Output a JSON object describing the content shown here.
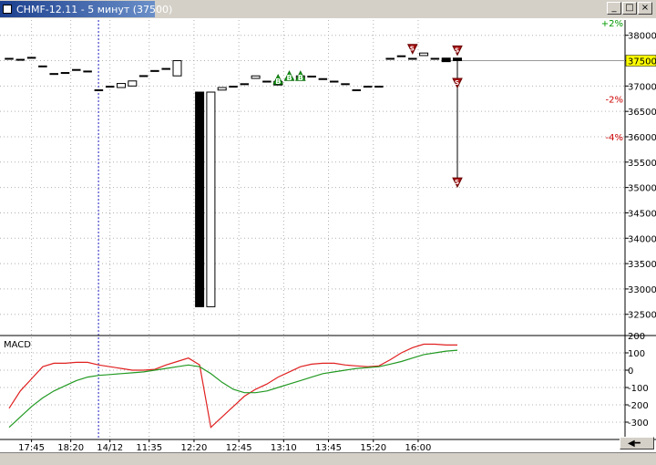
{
  "window": {
    "title": "CHMF-12.11 - 5 минут (37500)",
    "buttons": [
      "_",
      "□",
      "×"
    ]
  },
  "chart_data": [
    {
      "type": "candlestick",
      "name": "price-chart",
      "ylim": [
        32100,
        38300
      ],
      "yticks": [
        32500,
        33000,
        33500,
        34000,
        34500,
        35000,
        35500,
        36000,
        36500,
        37000,
        37500,
        38000
      ],
      "current_price_label": "37500",
      "current_price": 37500,
      "percent_markers": [
        {
          "label": "+2%",
          "value": 38250,
          "color": "#009900"
        },
        {
          "label": "-2%",
          "value": 36750,
          "color": "#cc0000"
        },
        {
          "label": "-4%",
          "value": 36000,
          "color": "#cc0000"
        }
      ],
      "candles": [
        {
          "i": 0,
          "o": 37550,
          "h": 37550,
          "l": 37550,
          "c": 37550
        },
        {
          "i": 1,
          "o": 37530,
          "h": 37530,
          "l": 37530,
          "c": 37530
        },
        {
          "i": 2,
          "o": 37570,
          "h": 37570,
          "l": 37570,
          "c": 37570
        },
        {
          "i": 3,
          "o": 37400,
          "h": 37400,
          "l": 37400,
          "c": 37400
        },
        {
          "i": 4,
          "o": 37250,
          "h": 37250,
          "l": 37250,
          "c": 37250
        },
        {
          "i": 5,
          "o": 37270,
          "h": 37270,
          "l": 37270,
          "c": 37270
        },
        {
          "i": 6,
          "o": 37330,
          "h": 37330,
          "l": 37330,
          "c": 37330
        },
        {
          "i": 7,
          "o": 37300,
          "h": 37300,
          "l": 37300,
          "c": 37300
        },
        {
          "i": 8,
          "o": 36930,
          "h": 36930,
          "l": 36930,
          "c": 36930
        },
        {
          "i": 9,
          "o": 37000,
          "h": 37000,
          "l": 37000,
          "c": 37000
        },
        {
          "i": 10,
          "o": 36970,
          "h": 37050,
          "l": 36970,
          "c": 37050
        },
        {
          "i": 11,
          "o": 37000,
          "h": 37100,
          "l": 37000,
          "c": 37100
        },
        {
          "i": 12,
          "o": 37210,
          "h": 37210,
          "l": 37210,
          "c": 37210
        },
        {
          "i": 13,
          "o": 37310,
          "h": 37310,
          "l": 37310,
          "c": 37310
        },
        {
          "i": 14,
          "o": 37350,
          "h": 37350,
          "l": 37350,
          "c": 37350
        },
        {
          "i": 15,
          "o": 37200,
          "h": 37500,
          "l": 37200,
          "c": 37500
        },
        {
          "i": 17,
          "o": 36880,
          "h": 36880,
          "l": 32650,
          "c": 32650
        },
        {
          "i": 18,
          "o": 32650,
          "h": 36880,
          "l": 32650,
          "c": 36880
        },
        {
          "i": 19,
          "o": 36920,
          "h": 36970,
          "l": 36920,
          "c": 36970
        },
        {
          "i": 20,
          "o": 37000,
          "h": 37000,
          "l": 37000,
          "c": 37000
        },
        {
          "i": 21,
          "o": 37050,
          "h": 37050,
          "l": 37050,
          "c": 37050
        },
        {
          "i": 22,
          "o": 37150,
          "h": 37200,
          "l": 37150,
          "c": 37200
        },
        {
          "i": 23,
          "o": 37100,
          "h": 37100,
          "l": 37100,
          "c": 37100
        },
        {
          "i": 24,
          "o": 37090,
          "h": 37090,
          "l": 37020,
          "c": 37020
        },
        {
          "i": 25,
          "o": 37150,
          "h": 37250,
          "l": 37150,
          "c": 37150
        },
        {
          "i": 26,
          "o": 37150,
          "h": 37250,
          "l": 37150,
          "c": 37200
        },
        {
          "i": 27,
          "o": 37200,
          "h": 37200,
          "l": 37200,
          "c": 37200
        },
        {
          "i": 28,
          "o": 37150,
          "h": 37150,
          "l": 37150,
          "c": 37150
        },
        {
          "i": 29,
          "o": 37100,
          "h": 37100,
          "l": 37100,
          "c": 37100
        },
        {
          "i": 30,
          "o": 37050,
          "h": 37050,
          "l": 37050,
          "c": 37050
        },
        {
          "i": 31,
          "o": 36930,
          "h": 36930,
          "l": 36930,
          "c": 36930
        },
        {
          "i": 32,
          "o": 37000,
          "h": 37000,
          "l": 37000,
          "c": 37000
        },
        {
          "i": 33,
          "o": 37000,
          "h": 37000,
          "l": 37000,
          "c": 37000
        },
        {
          "i": 34,
          "o": 37550,
          "h": 37550,
          "l": 37550,
          "c": 37550
        },
        {
          "i": 35,
          "o": 37600,
          "h": 37600,
          "l": 37600,
          "c": 37600
        },
        {
          "i": 36,
          "o": 37550,
          "h": 37550,
          "l": 37550,
          "c": 37550
        },
        {
          "i": 37,
          "o": 37600,
          "h": 37650,
          "l": 37600,
          "c": 37650
        },
        {
          "i": 38,
          "o": 37550,
          "h": 37550,
          "l": 37550,
          "c": 37550
        },
        {
          "i": 39,
          "o": 37550,
          "h": 37550,
          "l": 37480,
          "c": 37480
        },
        {
          "i": 40,
          "o": 37550,
          "h": 37550,
          "l": 35100,
          "c": 37500
        }
      ],
      "trade_markers": [
        {
          "i": 24,
          "price": 37130,
          "label": "B",
          "kind": "buy"
        },
        {
          "i": 25,
          "price": 37200,
          "label": "B",
          "kind": "buy"
        },
        {
          "i": 26,
          "price": 37200,
          "label": "B",
          "kind": "buy"
        },
        {
          "i": 36,
          "price": 37730,
          "label": "S",
          "kind": "sell"
        },
        {
          "i": 40,
          "price": 37700,
          "label": "S",
          "kind": "sell"
        },
        {
          "i": 40,
          "price": 37060,
          "label": "S",
          "kind": "sell"
        },
        {
          "i": 40,
          "price": 35100,
          "label": "S",
          "kind": "sell"
        }
      ]
    },
    {
      "type": "line",
      "name": "macd-panel",
      "title": "MACD",
      "ylim": [
        -400,
        200
      ],
      "yticks": [
        200,
        100,
        0,
        -100,
        -200,
        -300
      ],
      "series": [
        {
          "color": "#e02020",
          "values": [
            [
              0,
              -220
            ],
            [
              1,
              -120
            ],
            [
              2,
              -50
            ],
            [
              3,
              20
            ],
            [
              4,
              40
            ],
            [
              5,
              40
            ],
            [
              6,
              45
            ],
            [
              7,
              45
            ],
            [
              8,
              30
            ],
            [
              9,
              20
            ],
            [
              10,
              10
            ],
            [
              11,
              0
            ],
            [
              12,
              0
            ],
            [
              13,
              5
            ],
            [
              14,
              30
            ],
            [
              15,
              50
            ],
            [
              16,
              70
            ],
            [
              17,
              30
            ],
            [
              18,
              -330
            ],
            [
              19,
              -270
            ],
            [
              20,
              -210
            ],
            [
              21,
              -150
            ],
            [
              22,
              -110
            ],
            [
              23,
              -80
            ],
            [
              24,
              -40
            ],
            [
              25,
              -10
            ],
            [
              26,
              20
            ],
            [
              27,
              35
            ],
            [
              28,
              40
            ],
            [
              29,
              40
            ],
            [
              30,
              30
            ],
            [
              31,
              25
            ],
            [
              32,
              20
            ],
            [
              33,
              25
            ],
            [
              34,
              60
            ],
            [
              35,
              100
            ],
            [
              36,
              130
            ],
            [
              37,
              150
            ],
            [
              38,
              150
            ],
            [
              39,
              145
            ],
            [
              40,
              145
            ]
          ]
        },
        {
          "color": "#229922",
          "values": [
            [
              0,
              -330
            ],
            [
              1,
              -270
            ],
            [
              2,
              -210
            ],
            [
              3,
              -160
            ],
            [
              4,
              -120
            ],
            [
              5,
              -90
            ],
            [
              6,
              -60
            ],
            [
              7,
              -40
            ],
            [
              8,
              -30
            ],
            [
              9,
              -25
            ],
            [
              10,
              -20
            ],
            [
              11,
              -15
            ],
            [
              12,
              -10
            ],
            [
              13,
              0
            ],
            [
              14,
              10
            ],
            [
              15,
              20
            ],
            [
              16,
              30
            ],
            [
              17,
              20
            ],
            [
              18,
              -20
            ],
            [
              19,
              -70
            ],
            [
              20,
              -110
            ],
            [
              21,
              -130
            ],
            [
              22,
              -130
            ],
            [
              23,
              -120
            ],
            [
              24,
              -100
            ],
            [
              25,
              -80
            ],
            [
              26,
              -60
            ],
            [
              27,
              -40
            ],
            [
              28,
              -20
            ],
            [
              29,
              -10
            ],
            [
              30,
              0
            ],
            [
              31,
              10
            ],
            [
              32,
              15
            ],
            [
              33,
              20
            ],
            [
              34,
              35
            ],
            [
              35,
              50
            ],
            [
              36,
              70
            ],
            [
              37,
              90
            ],
            [
              38,
              100
            ],
            [
              39,
              110
            ],
            [
              40,
              115
            ]
          ]
        }
      ]
    }
  ],
  "time_axis": [
    {
      "label": "17:45",
      "i": 2
    },
    {
      "label": "18:20",
      "i": 5.5
    },
    {
      "label": "14/12",
      "i": 9
    },
    {
      "label": "11:35",
      "i": 12.5
    },
    {
      "label": "12:20",
      "i": 16.5
    },
    {
      "label": "12:45",
      "i": 20.5
    },
    {
      "label": "13:10",
      "i": 24.5
    },
    {
      "label": "13:45",
      "i": 28.5
    },
    {
      "label": "15:20",
      "i": 32.5
    },
    {
      "label": "16:00",
      "i": 36.5
    }
  ],
  "day_separator_i": 7,
  "colors": {
    "grid": "#b0b0b0",
    "separator": "#2020c0",
    "buy_marker": "#22aa22",
    "sell_marker": "#aa1111",
    "price_line": "#999999"
  }
}
